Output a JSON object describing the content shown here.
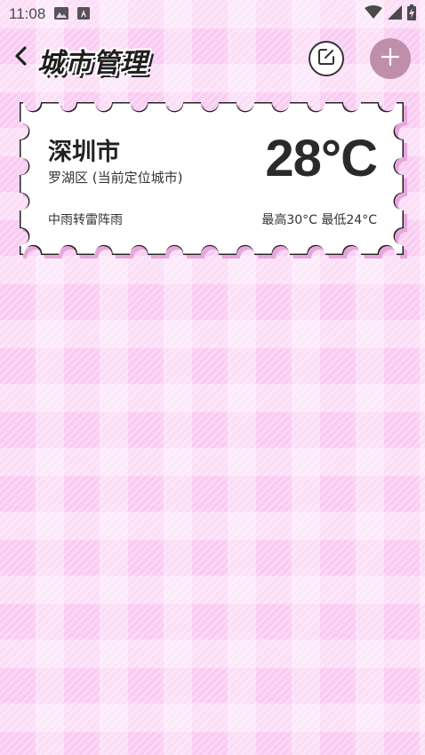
{
  "status_bar": {
    "time": "11:08",
    "left_icons": [
      "image-icon",
      "a-icon"
    ],
    "right_icons": [
      "wifi-icon",
      "signal-icon",
      "battery-icon"
    ]
  },
  "header": {
    "title": "城市管理",
    "back_icon": "chevron-left-icon",
    "edit_icon": "edit-icon",
    "add_icon": "plus-icon"
  },
  "cities": [
    {
      "name": "深圳市",
      "district": "罗湖区 (当前定位城市)",
      "temperature": "28°C",
      "weather": "中雨转雷阵雨",
      "range": "最高30°C 最低24°C"
    }
  ],
  "colors": {
    "background": "#f9cdf3",
    "add_button": "#bf8fa9",
    "card_shadow": "#e7a6dc",
    "text": "#222222"
  }
}
